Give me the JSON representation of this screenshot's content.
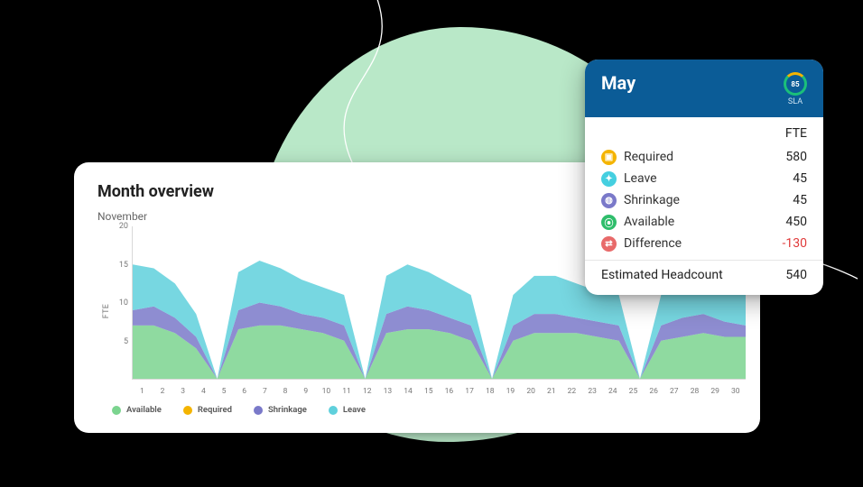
{
  "blob_color": "#b9e8c8",
  "chart": {
    "title": "Month overview",
    "subtitle": "November",
    "y_axis_label": "FTE",
    "legend": [
      {
        "label": "Available",
        "color": "#7bd48f"
      },
      {
        "label": "Required",
        "color": "#f4b400"
      },
      {
        "label": "Shrinkage",
        "color": "#7a79c9"
      },
      {
        "label": "Leave",
        "color": "#5fd0dc"
      }
    ]
  },
  "chart_data": {
    "type": "area",
    "title": "Month overview",
    "subtitle": "November",
    "xlabel": "",
    "ylabel": "FTE",
    "ylim": [
      0,
      20
    ],
    "y_ticks": [
      5,
      10,
      15,
      20
    ],
    "categories": [
      1,
      2,
      3,
      4,
      5,
      6,
      7,
      8,
      9,
      10,
      11,
      12,
      13,
      14,
      15,
      16,
      17,
      18,
      19,
      20,
      21,
      22,
      23,
      24,
      25,
      26,
      27,
      28,
      29,
      30
    ],
    "series": [
      {
        "name": "Available",
        "color": "#7bd48f",
        "values": [
          7,
          7,
          6,
          4,
          0,
          6.5,
          7,
          7,
          6.5,
          6,
          5,
          0,
          6,
          6.5,
          6.5,
          6,
          5,
          0,
          5,
          6,
          6,
          6,
          5.5,
          5,
          0,
          5,
          5.5,
          6,
          5.5,
          5.5
        ]
      },
      {
        "name": "Shrinkage",
        "color": "#7a79c9",
        "values": [
          2,
          2.5,
          2,
          1.5,
          0,
          2.5,
          3,
          2.5,
          2,
          2,
          2,
          0,
          2.5,
          3,
          2.5,
          2,
          2,
          0,
          2,
          2.5,
          2.5,
          2,
          2,
          2,
          0,
          2,
          2.5,
          2.5,
          2,
          1.5
        ]
      },
      {
        "name": "Leave",
        "color": "#5fd0dc",
        "values": [
          6,
          5,
          4.5,
          3,
          0,
          5,
          5.5,
          5,
          4.5,
          4,
          4,
          0,
          5,
          5.5,
          5,
          4.5,
          4,
          0,
          4,
          5,
          5,
          4.5,
          4,
          4,
          0,
          4,
          5,
          5,
          4.5,
          4
        ]
      },
      {
        "name": "Required",
        "color": "#f4b400",
        "type": "line",
        "values": [
          0.5,
          0.5,
          0.5,
          0.5,
          0.5,
          0.5,
          0.5,
          0.5,
          0.5,
          0.5,
          0.5,
          0.5,
          0.5,
          0.5,
          0.5,
          0.5,
          0.5,
          0.5,
          0.5,
          0.5,
          0.5,
          0.5,
          0.5,
          0.5,
          0.5,
          0.5,
          0.5,
          0.5,
          0.5,
          0.5
        ]
      }
    ]
  },
  "detail": {
    "title": "May",
    "sla_value": "85",
    "sla_label": "SLA",
    "fte_header": "FTE",
    "rows": [
      {
        "icon_color": "#f4b400",
        "glyph": "▣",
        "label": "Required",
        "value": "580"
      },
      {
        "icon_color": "#45cfe0",
        "glyph": "✦",
        "label": "Leave",
        "value": "45"
      },
      {
        "icon_color": "#7a79c9",
        "glyph": "◍",
        "label": "Shrinkage",
        "value": "45"
      },
      {
        "icon_color": "#2fbd6b",
        "glyph": "⦿",
        "label": "Available",
        "value": "450"
      },
      {
        "icon_color": "#e86a6a",
        "glyph": "⇄",
        "label": "Difference",
        "value": "-130",
        "negative": true
      }
    ],
    "headcount_label": "Estimated Headcount",
    "headcount_value": "540"
  }
}
